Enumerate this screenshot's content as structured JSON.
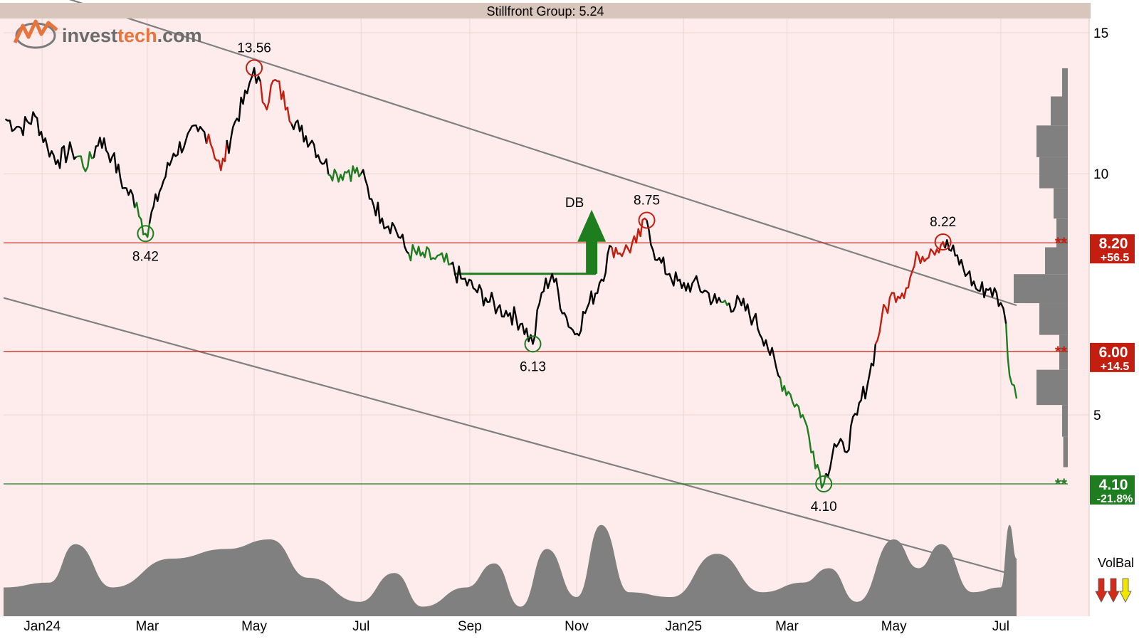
{
  "title": "Stillfront Group: 5.24",
  "logo": {
    "text_a": "invest",
    "text_b": "tech",
    "text_c": ".com",
    "brand_color": "#e8743b"
  },
  "indicator": {
    "label": "VolBal",
    "arrows": [
      "down-red",
      "down-red",
      "down-yellow"
    ]
  },
  "colors": {
    "background": "#fdeceb",
    "header": "#d8c6bc",
    "price_line": "#000000",
    "buy_signal": "#1e7d1e",
    "sell_signal": "#c41e10",
    "resistance": "#c41e10",
    "support": "#1e7d1e",
    "trend_channel": "#808080",
    "volume": "#808080"
  },
  "chart_data": {
    "type": "line",
    "title": "Stillfront Group: 5.24",
    "xlabel": "",
    "ylabel": "",
    "y_scale": "log",
    "ylim": [
      3.45,
      16
    ],
    "x_range": [
      "2023-12-10",
      "2025-07-31"
    ],
    "x_ticks": [
      {
        "label": "Jan24",
        "date": "2024-01-01"
      },
      {
        "label": "Mar",
        "date": "2024-03-01"
      },
      {
        "label": "May",
        "date": "2024-05-01"
      },
      {
        "label": "Jul",
        "date": "2024-07-01"
      },
      {
        "label": "Sep",
        "date": "2024-09-01"
      },
      {
        "label": "Nov",
        "date": "2024-11-01"
      },
      {
        "label": "Jan25",
        "date": "2025-01-01"
      },
      {
        "label": "Mar",
        "date": "2025-03-01"
      },
      {
        "label": "May",
        "date": "2025-05-01"
      },
      {
        "label": "Jul",
        "date": "2025-07-01"
      }
    ],
    "y_ticks": [
      {
        "label": "15",
        "value": 15
      },
      {
        "label": "10",
        "value": 10
      },
      {
        "label": "5",
        "value": 5
      }
    ],
    "series": [
      {
        "values": [
          [
            "2023-12-11",
            11.7
          ],
          [
            "2023-12-20",
            11.4
          ],
          [
            "2023-12-28",
            11.8
          ],
          [
            "2024-01-04",
            10.8
          ],
          [
            "2024-01-10",
            10.4
          ],
          [
            "2024-01-18",
            10.7
          ],
          [
            "2024-01-27",
            10.2
          ],
          [
            "2024-02-03",
            11.1
          ],
          [
            "2024-02-10",
            10.5
          ],
          [
            "2024-02-17",
            9.6
          ],
          [
            "2024-02-24",
            9.2
          ],
          [
            "2024-02-29",
            8.42
          ],
          [
            "2024-03-08",
            9.5
          ],
          [
            "2024-03-16",
            10.6
          ],
          [
            "2024-03-23",
            11.0
          ],
          [
            "2024-03-30",
            11.3
          ],
          [
            "2024-04-05",
            11.2
          ],
          [
            "2024-04-12",
            10.1
          ],
          [
            "2024-04-20",
            11.6
          ],
          [
            "2024-04-27",
            12.6
          ],
          [
            "2024-05-01",
            13.56
          ],
          [
            "2024-05-07",
            12.2
          ],
          [
            "2024-05-13",
            13.1
          ],
          [
            "2024-05-20",
            12.1
          ],
          [
            "2024-05-27",
            11.3
          ],
          [
            "2024-06-03",
            11.0
          ],
          [
            "2024-06-10",
            10.3
          ],
          [
            "2024-06-17",
            10.0
          ],
          [
            "2024-06-24",
            10.1
          ],
          [
            "2024-07-01",
            10.0
          ],
          [
            "2024-07-07",
            9.3
          ],
          [
            "2024-07-13",
            8.8
          ],
          [
            "2024-07-20",
            8.6
          ],
          [
            "2024-07-27",
            8.0
          ],
          [
            "2024-08-04",
            7.9
          ],
          [
            "2024-08-11",
            7.85
          ],
          [
            "2024-08-20",
            7.7
          ],
          [
            "2024-08-27",
            7.4
          ],
          [
            "2024-09-03",
            7.2
          ],
          [
            "2024-09-10",
            7.0
          ],
          [
            "2024-09-17",
            6.8
          ],
          [
            "2024-09-24",
            6.7
          ],
          [
            "2024-10-01",
            6.5
          ],
          [
            "2024-10-07",
            6.13
          ],
          [
            "2024-10-12",
            7.1
          ],
          [
            "2024-10-18",
            7.5
          ],
          [
            "2024-10-25",
            6.7
          ],
          [
            "2024-10-31",
            6.3
          ],
          [
            "2024-11-07",
            6.8
          ],
          [
            "2024-11-14",
            7.3
          ],
          [
            "2024-11-21",
            8.1
          ],
          [
            "2024-11-28",
            8.0
          ],
          [
            "2024-12-05",
            8.2
          ],
          [
            "2024-12-11",
            8.75
          ],
          [
            "2024-12-17",
            7.8
          ],
          [
            "2024-12-24",
            7.5
          ],
          [
            "2024-12-31",
            7.2
          ],
          [
            "2025-01-06",
            7.3
          ],
          [
            "2025-01-13",
            7.15
          ],
          [
            "2025-01-20",
            6.9
          ],
          [
            "2025-01-27",
            6.9
          ],
          [
            "2025-02-03",
            6.85
          ],
          [
            "2025-02-10",
            6.6
          ],
          [
            "2025-02-17",
            6.2
          ],
          [
            "2025-02-24",
            5.6
          ],
          [
            "2025-03-03",
            5.3
          ],
          [
            "2025-03-10",
            5.0
          ],
          [
            "2025-03-16",
            4.5
          ],
          [
            "2025-03-22",
            4.1
          ],
          [
            "2025-03-28",
            4.6
          ],
          [
            "2025-04-03",
            4.5
          ],
          [
            "2025-04-10",
            5.0
          ],
          [
            "2025-04-17",
            5.6
          ],
          [
            "2025-04-24",
            6.6
          ],
          [
            "2025-05-01",
            7.1
          ],
          [
            "2025-05-08",
            7.2
          ],
          [
            "2025-05-15",
            7.9
          ],
          [
            "2025-05-22",
            8.05
          ],
          [
            "2025-05-29",
            8.22
          ],
          [
            "2025-06-05",
            7.9
          ],
          [
            "2025-06-12",
            7.5
          ],
          [
            "2025-06-18",
            7.15
          ],
          [
            "2025-06-25",
            7.2
          ],
          [
            "2025-07-01",
            6.9
          ],
          [
            "2025-07-04",
            6.5
          ],
          [
            "2025-07-06",
            5.6
          ],
          [
            "2025-07-10",
            5.24
          ]
        ]
      }
    ],
    "horizontal_lines": [
      {
        "value": 8.2,
        "kind": "resistance",
        "label": "8.20",
        "change": "+56.5"
      },
      {
        "value": 6.0,
        "kind": "resistance",
        "label": "6.00",
        "change": "+14.5"
      },
      {
        "value": 4.1,
        "kind": "support",
        "label": "4.10",
        "change": "-21.8%"
      }
    ],
    "trend_channel": [
      {
        "from": [
          "2023-12-19",
          17.3
        ],
        "to": [
          "2025-07-10",
          6.85
        ]
      },
      {
        "from": [
          "2023-12-10",
          7.0
        ],
        "to": [
          "2025-07-10",
          3.15
        ]
      }
    ],
    "turning_points": [
      {
        "date": "2024-02-29",
        "value": 8.42,
        "label": "8.42",
        "kind": "bottom"
      },
      {
        "date": "2024-05-01",
        "value": 13.56,
        "label": "13.56",
        "kind": "top"
      },
      {
        "date": "2024-10-07",
        "value": 6.13,
        "label": "6.13",
        "kind": "bottom"
      },
      {
        "date": "2024-12-11",
        "value": 8.75,
        "label": "8.75",
        "kind": "top"
      },
      {
        "date": "2025-03-22",
        "value": 4.1,
        "label": "4.10",
        "kind": "bottom"
      },
      {
        "date": "2025-05-29",
        "value": 8.22,
        "label": "8.22",
        "kind": "top"
      }
    ],
    "pattern": {
      "label": "DB",
      "neckline": {
        "from": "2024-08-23",
        "to": "2024-11-12",
        "value": 7.5
      },
      "arrow": "up"
    },
    "volume_profile": [
      {
        "value": 13.0,
        "size": 0.1
      },
      {
        "value": 12.0,
        "size": 0.3
      },
      {
        "value": 11.0,
        "size": 0.55
      },
      {
        "value": 10.0,
        "size": 0.5
      },
      {
        "value": 9.2,
        "size": 0.25
      },
      {
        "value": 8.4,
        "size": 0.2
      },
      {
        "value": 7.8,
        "size": 0.4
      },
      {
        "value": 7.2,
        "size": 0.95
      },
      {
        "value": 6.6,
        "size": 0.5
      },
      {
        "value": 6.0,
        "size": 0.15
      },
      {
        "value": 5.4,
        "size": 0.55
      },
      {
        "value": 4.9,
        "size": 0.1
      },
      {
        "value": 4.5,
        "size": 0.08
      }
    ],
    "volume_balance": [
      [
        "2023-12-10",
        0.3
      ],
      [
        "2024-01-05",
        0.35
      ],
      [
        "2024-01-20",
        0.75
      ],
      [
        "2024-02-10",
        0.3
      ],
      [
        "2024-03-15",
        0.6
      ],
      [
        "2024-04-15",
        0.7
      ],
      [
        "2024-05-10",
        0.8
      ],
      [
        "2024-06-01",
        0.4
      ],
      [
        "2024-06-30",
        0.15
      ],
      [
        "2024-07-20",
        0.45
      ],
      [
        "2024-08-05",
        0.1
      ],
      [
        "2024-08-30",
        0.3
      ],
      [
        "2024-09-15",
        0.55
      ],
      [
        "2024-09-30",
        0.1
      ],
      [
        "2024-10-15",
        0.7
      ],
      [
        "2024-11-01",
        0.2
      ],
      [
        "2024-11-15",
        0.95
      ],
      [
        "2024-12-01",
        0.25
      ],
      [
        "2024-12-25",
        0.2
      ],
      [
        "2025-01-20",
        0.65
      ],
      [
        "2025-02-15",
        0.25
      ],
      [
        "2025-03-10",
        0.35
      ],
      [
        "2025-03-25",
        0.5
      ],
      [
        "2025-04-10",
        0.15
      ],
      [
        "2025-05-01",
        0.8
      ],
      [
        "2025-05-15",
        0.5
      ],
      [
        "2025-05-28",
        0.75
      ],
      [
        "2025-06-15",
        0.25
      ],
      [
        "2025-07-01",
        0.3
      ],
      [
        "2025-07-06",
        0.95
      ],
      [
        "2025-07-10",
        0.6
      ]
    ]
  }
}
